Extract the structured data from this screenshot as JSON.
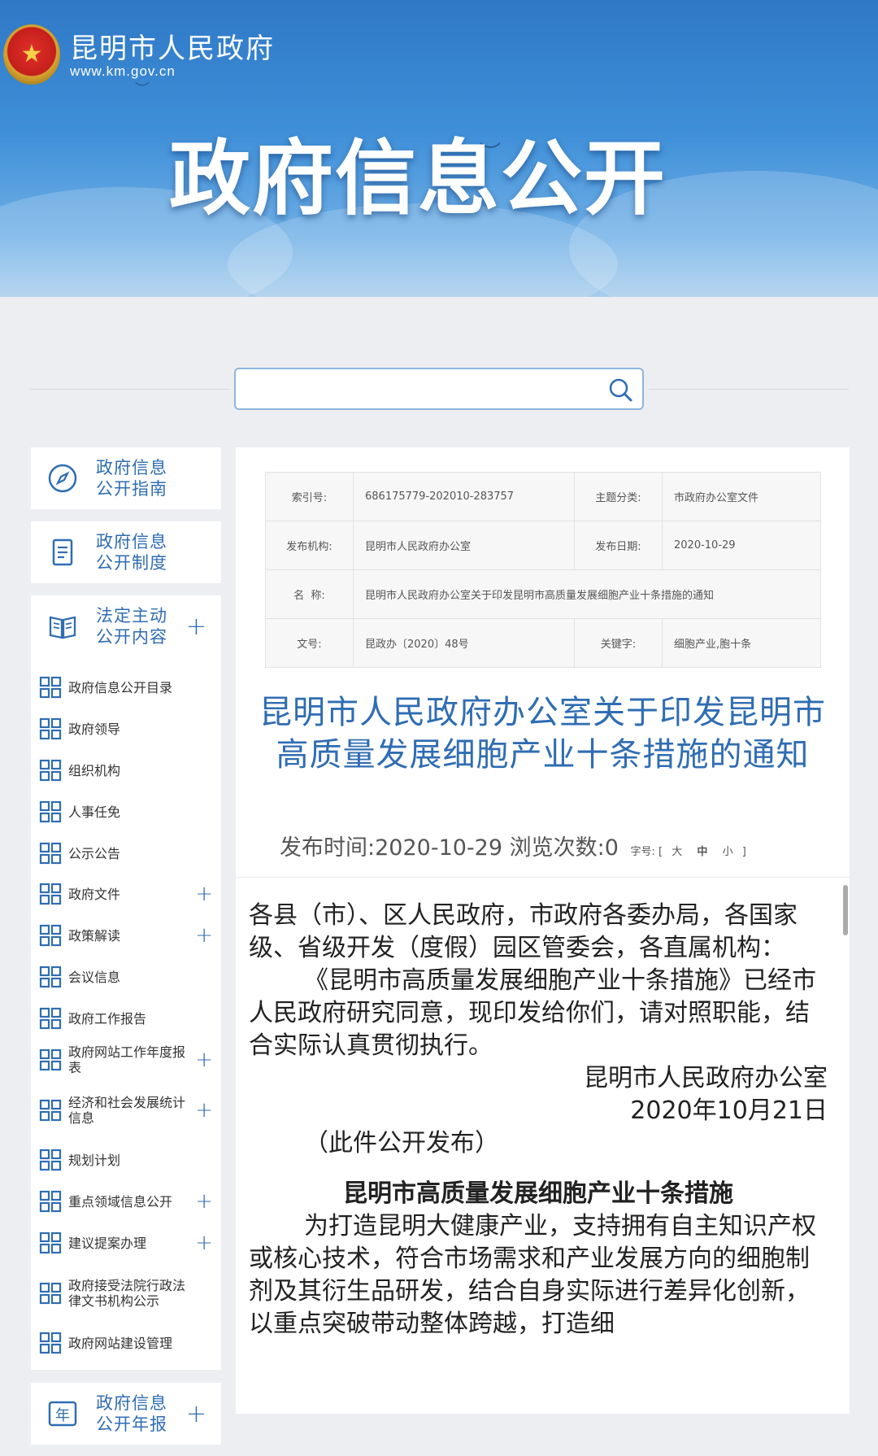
{
  "header": {
    "site_name": "昆明市人民政府",
    "site_url": "www.km.gov.cn",
    "banner_title": "政府信息公开"
  },
  "search": {
    "value": "",
    "placeholder": ""
  },
  "sidebar": {
    "cards": [
      {
        "label": "政府信息\n公开指南",
        "icon": "compass-icon",
        "expandable": false
      },
      {
        "label": "政府信息\n公开制度",
        "icon": "document-icon",
        "expandable": false
      },
      {
        "label": "法定主动\n公开内容",
        "icon": "book-icon",
        "expandable": true
      }
    ],
    "items": [
      {
        "label": "政府信息公开目录",
        "expandable": false
      },
      {
        "label": "政府领导",
        "expandable": false
      },
      {
        "label": "组织机构",
        "expandable": false
      },
      {
        "label": "人事任免",
        "expandable": false
      },
      {
        "label": "公示公告",
        "expandable": false
      },
      {
        "label": "政府文件",
        "expandable": true
      },
      {
        "label": "政策解读",
        "expandable": true
      },
      {
        "label": "会议信息",
        "expandable": false
      },
      {
        "label": "政府工作报告",
        "expandable": false
      },
      {
        "label": "政府网站工作年度报表",
        "expandable": true
      },
      {
        "label": "经济和社会发展统计信息",
        "expandable": true
      },
      {
        "label": "规划计划",
        "expandable": false
      },
      {
        "label": "重点领域信息公开",
        "expandable": true
      },
      {
        "label": "建议提案办理",
        "expandable": true
      },
      {
        "label": "政府接受法院行政法律文书机构公示",
        "expandable": false
      },
      {
        "label": "政府网站建设管理",
        "expandable": false
      }
    ],
    "annual_report": {
      "label": "政府信息\n公开年报",
      "icon": "year-icon",
      "icon_text": "年",
      "expandable": true
    }
  },
  "meta": {
    "index_label": "索引号:",
    "index_value": "686175779-202010-283757",
    "topic_label": "主题分类:",
    "topic_value": "市政府办公室文件",
    "org_label": "发布机构:",
    "org_value": "昆明市人民政府办公室",
    "date_label": "发布日期:",
    "date_value": "2020-10-29",
    "name_label": "名  称:",
    "name_value": "昆明市人民政府办公室关于印发昆明市高质量发展细胞产业十条措施的通知",
    "docno_label": "文号:",
    "docno_value": "昆政办〔2020〕48号",
    "keyword_label": "关键字:",
    "keyword_value": "细胞产业,胞十条"
  },
  "article": {
    "title": "昆明市人民政府办公室关于印发昆明市高质量发展细胞产业十条措施的通知",
    "publish_label": "发布时间:",
    "publish_date": "2020-10-29",
    "views_label": "浏览次数:",
    "views": "0",
    "font_size_label": "字号:",
    "font_sizes": [
      "大",
      "中",
      "小"
    ],
    "bracket_open": "[",
    "bracket_close": "]",
    "salutation": "各县（市）、区人民政府，市政府各委办局，各国家级、省级开发（度假）园区管委会，各直属机构：",
    "paragraph1": "《昆明市高质量发展细胞产业十条措施》已经市人民政府研究同意，现印发给你们，请对照职能，结合实际认真贯彻执行。",
    "signature_org": "昆明市人民政府办公室",
    "signature_date": "2020年10月21日",
    "public_note": "（此件公开发布）",
    "section_title": "昆明市高质量发展细胞产业十条措施",
    "paragraph2": "为打造昆明大健康产业，支持拥有自主知识产权或核心技术，符合市场需求和产业发展方向的细胞制剂及其衍生品研发，结合自身实际进行差异化创新，以重点突破带动整体跨越，打造细"
  }
}
